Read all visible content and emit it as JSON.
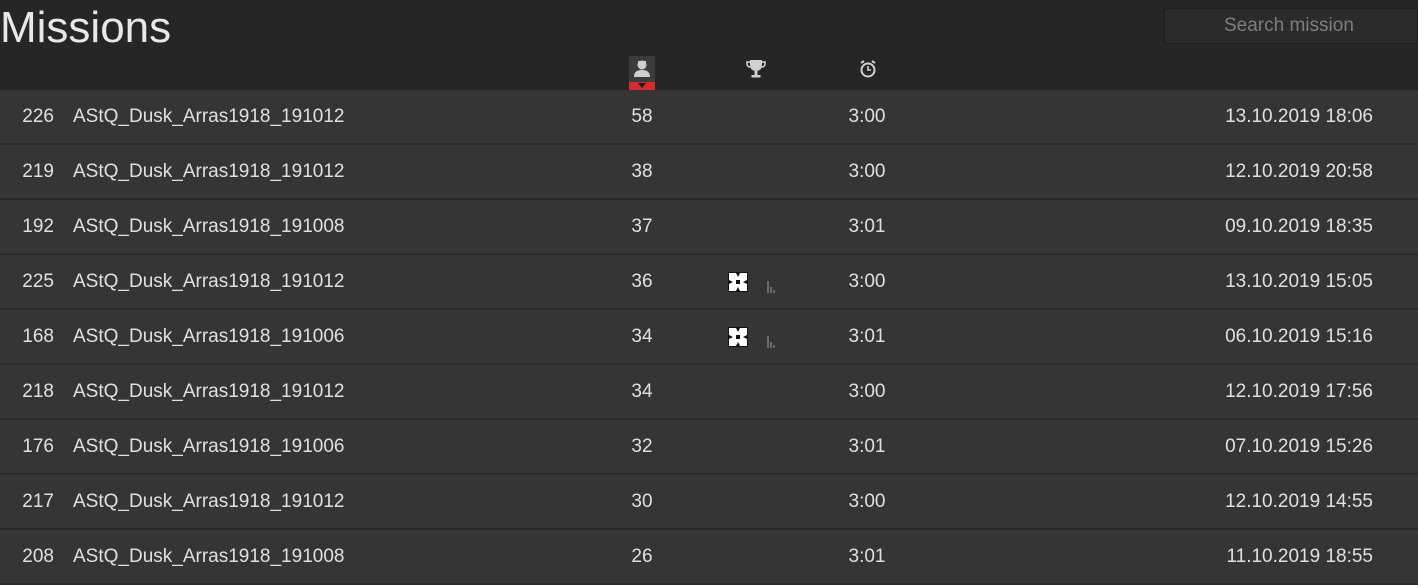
{
  "header": {
    "title": "Missions",
    "search_placeholder": "Search mission"
  },
  "columns": {
    "players_icon": "player-icon",
    "trophy_icon": "trophy-icon",
    "timer_icon": "alarm-clock-icon",
    "sorted_by": "players",
    "sort_direction": "descending",
    "sort_color": "#d62b2b"
  },
  "missions": [
    {
      "id": "226",
      "name": "AStQ_Dusk_Arras1918_191012",
      "players": "58",
      "badge": false,
      "duration": "3:00",
      "date": "13.10.2019 18:06"
    },
    {
      "id": "219",
      "name": "AStQ_Dusk_Arras1918_191012",
      "players": "38",
      "badge": false,
      "duration": "3:00",
      "date": "12.10.2019 20:58"
    },
    {
      "id": "192",
      "name": "AStQ_Dusk_Arras1918_191008",
      "players": "37",
      "badge": false,
      "duration": "3:01",
      "date": "09.10.2019 18:35"
    },
    {
      "id": "225",
      "name": "AStQ_Dusk_Arras1918_191012",
      "players": "36",
      "badge": true,
      "duration": "3:00",
      "date": "13.10.2019 15:05"
    },
    {
      "id": "168",
      "name": "AStQ_Dusk_Arras1918_191006",
      "players": "34",
      "badge": true,
      "duration": "3:01",
      "date": "06.10.2019 15:16"
    },
    {
      "id": "218",
      "name": "AStQ_Dusk_Arras1918_191012",
      "players": "34",
      "badge": false,
      "duration": "3:00",
      "date": "12.10.2019 17:56"
    },
    {
      "id": "176",
      "name": "AStQ_Dusk_Arras1918_191006",
      "players": "32",
      "badge": false,
      "duration": "3:01",
      "date": "07.10.2019 15:26"
    },
    {
      "id": "217",
      "name": "AStQ_Dusk_Arras1918_191012",
      "players": "30",
      "badge": false,
      "duration": "3:00",
      "date": "12.10.2019 14:55"
    },
    {
      "id": "208",
      "name": "AStQ_Dusk_Arras1918_191008",
      "players": "26",
      "badge": false,
      "duration": "3:01",
      "date": "11.10.2019 18:55"
    }
  ]
}
